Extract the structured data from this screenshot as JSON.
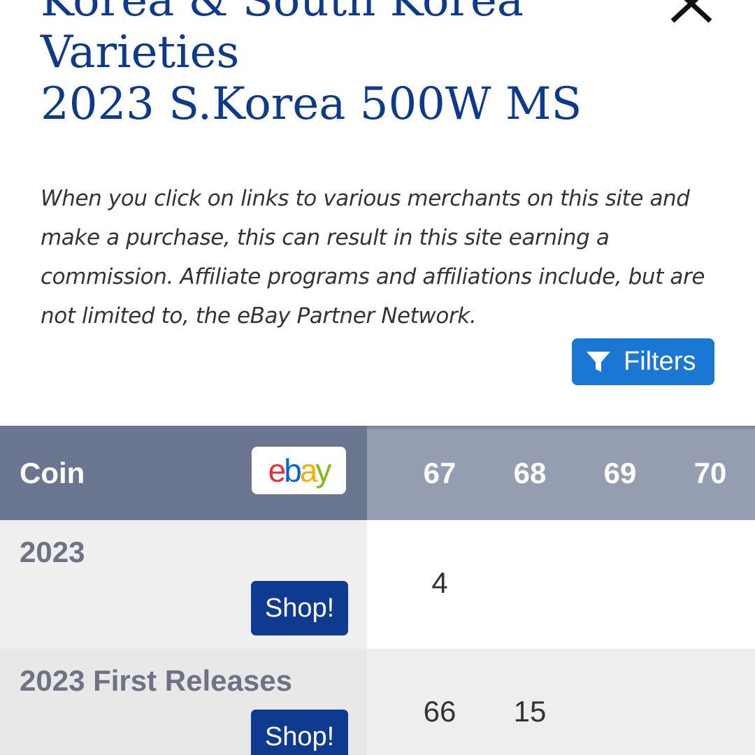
{
  "header": {
    "title_lines": [
      "Korea & South Korea",
      "Varieties",
      "2023 S.Korea 500W MS"
    ]
  },
  "disclaimer": "When you click on links to various merchants on this site and make a purchase, this can result in this site earning a commission. Affiliate programs and affiliations include, but are not limited to, the eBay Partner Network.",
  "filters_button": {
    "label": "Filters",
    "icon": "funnel-icon",
    "color": "#1a78d4"
  },
  "table": {
    "coin_header": "Coin",
    "ebay_logo": {
      "letters": [
        "e",
        "b",
        "a",
        "y"
      ],
      "colors": [
        "#e53238",
        "#0064d2",
        "#f5af02",
        "#86b817"
      ]
    },
    "grades": [
      "67",
      "68",
      "69",
      "70"
    ],
    "rows": [
      {
        "coin": "2023",
        "shop_label": "Shop!",
        "counts": [
          "4",
          "",
          "",
          ""
        ]
      },
      {
        "coin": "2023 First Releases",
        "shop_label": "Shop!",
        "counts": [
          "66",
          "15",
          "",
          ""
        ]
      }
    ],
    "colors": {
      "coin_header_bg": "#6a7590",
      "grade_header_bg": "#959db0",
      "shop_button": "#0e3a8f"
    }
  },
  "close_icon": "close-icon"
}
